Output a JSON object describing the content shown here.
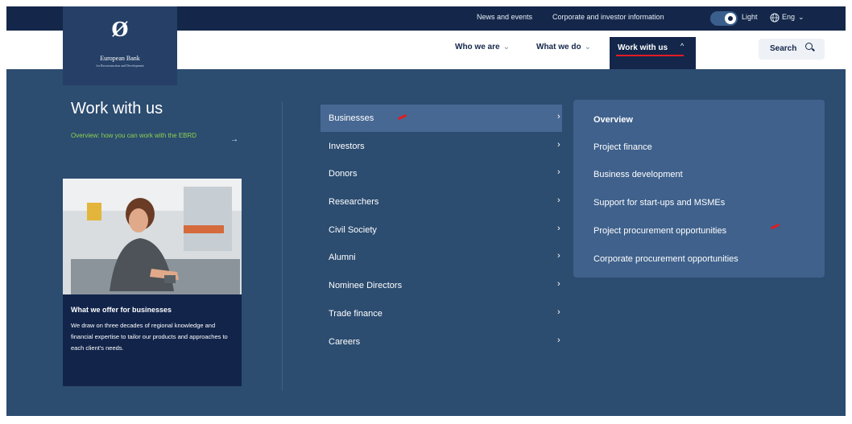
{
  "topbar": {
    "news_label": "News and events",
    "corporate_label": "Corporate and investor information",
    "theme_label": "Light",
    "language_label": "Eng"
  },
  "logo": {
    "mark": "Ø",
    "name": "European Bank",
    "subtitle": "for Reconstruction and Development"
  },
  "nav": {
    "who_label": "Who we are",
    "what_label": "What we do",
    "work_label": "Work with us",
    "search_label": "Search"
  },
  "left_panel": {
    "title": "Work with us",
    "overview_link": "Overview: how you can work with the EBRD",
    "card_title": "What we offer for businesses",
    "card_text": "We draw on three decades of regional knowledge and financial expertise to tailor our products and approaches to each client's needs."
  },
  "menu": {
    "items": [
      {
        "label": "Businesses"
      },
      {
        "label": "Investors"
      },
      {
        "label": "Donors"
      },
      {
        "label": "Researchers"
      },
      {
        "label": "Civil Society"
      },
      {
        "label": "Alumni"
      },
      {
        "label": "Nominee Directors"
      },
      {
        "label": "Trade finance"
      },
      {
        "label": "Careers"
      }
    ]
  },
  "submenu": {
    "items": [
      {
        "label": "Overview"
      },
      {
        "label": "Project finance"
      },
      {
        "label": "Business development"
      },
      {
        "label": "Support for start-ups and MSMEs"
      },
      {
        "label": "Project procurement opportunities"
      },
      {
        "label": "Corporate procurement opportunities"
      }
    ]
  },
  "colors": {
    "dark_navy": "#14274a",
    "panel_blue": "#2c4c70",
    "accent_red": "#e31b23",
    "link_green": "#8bd34d"
  }
}
